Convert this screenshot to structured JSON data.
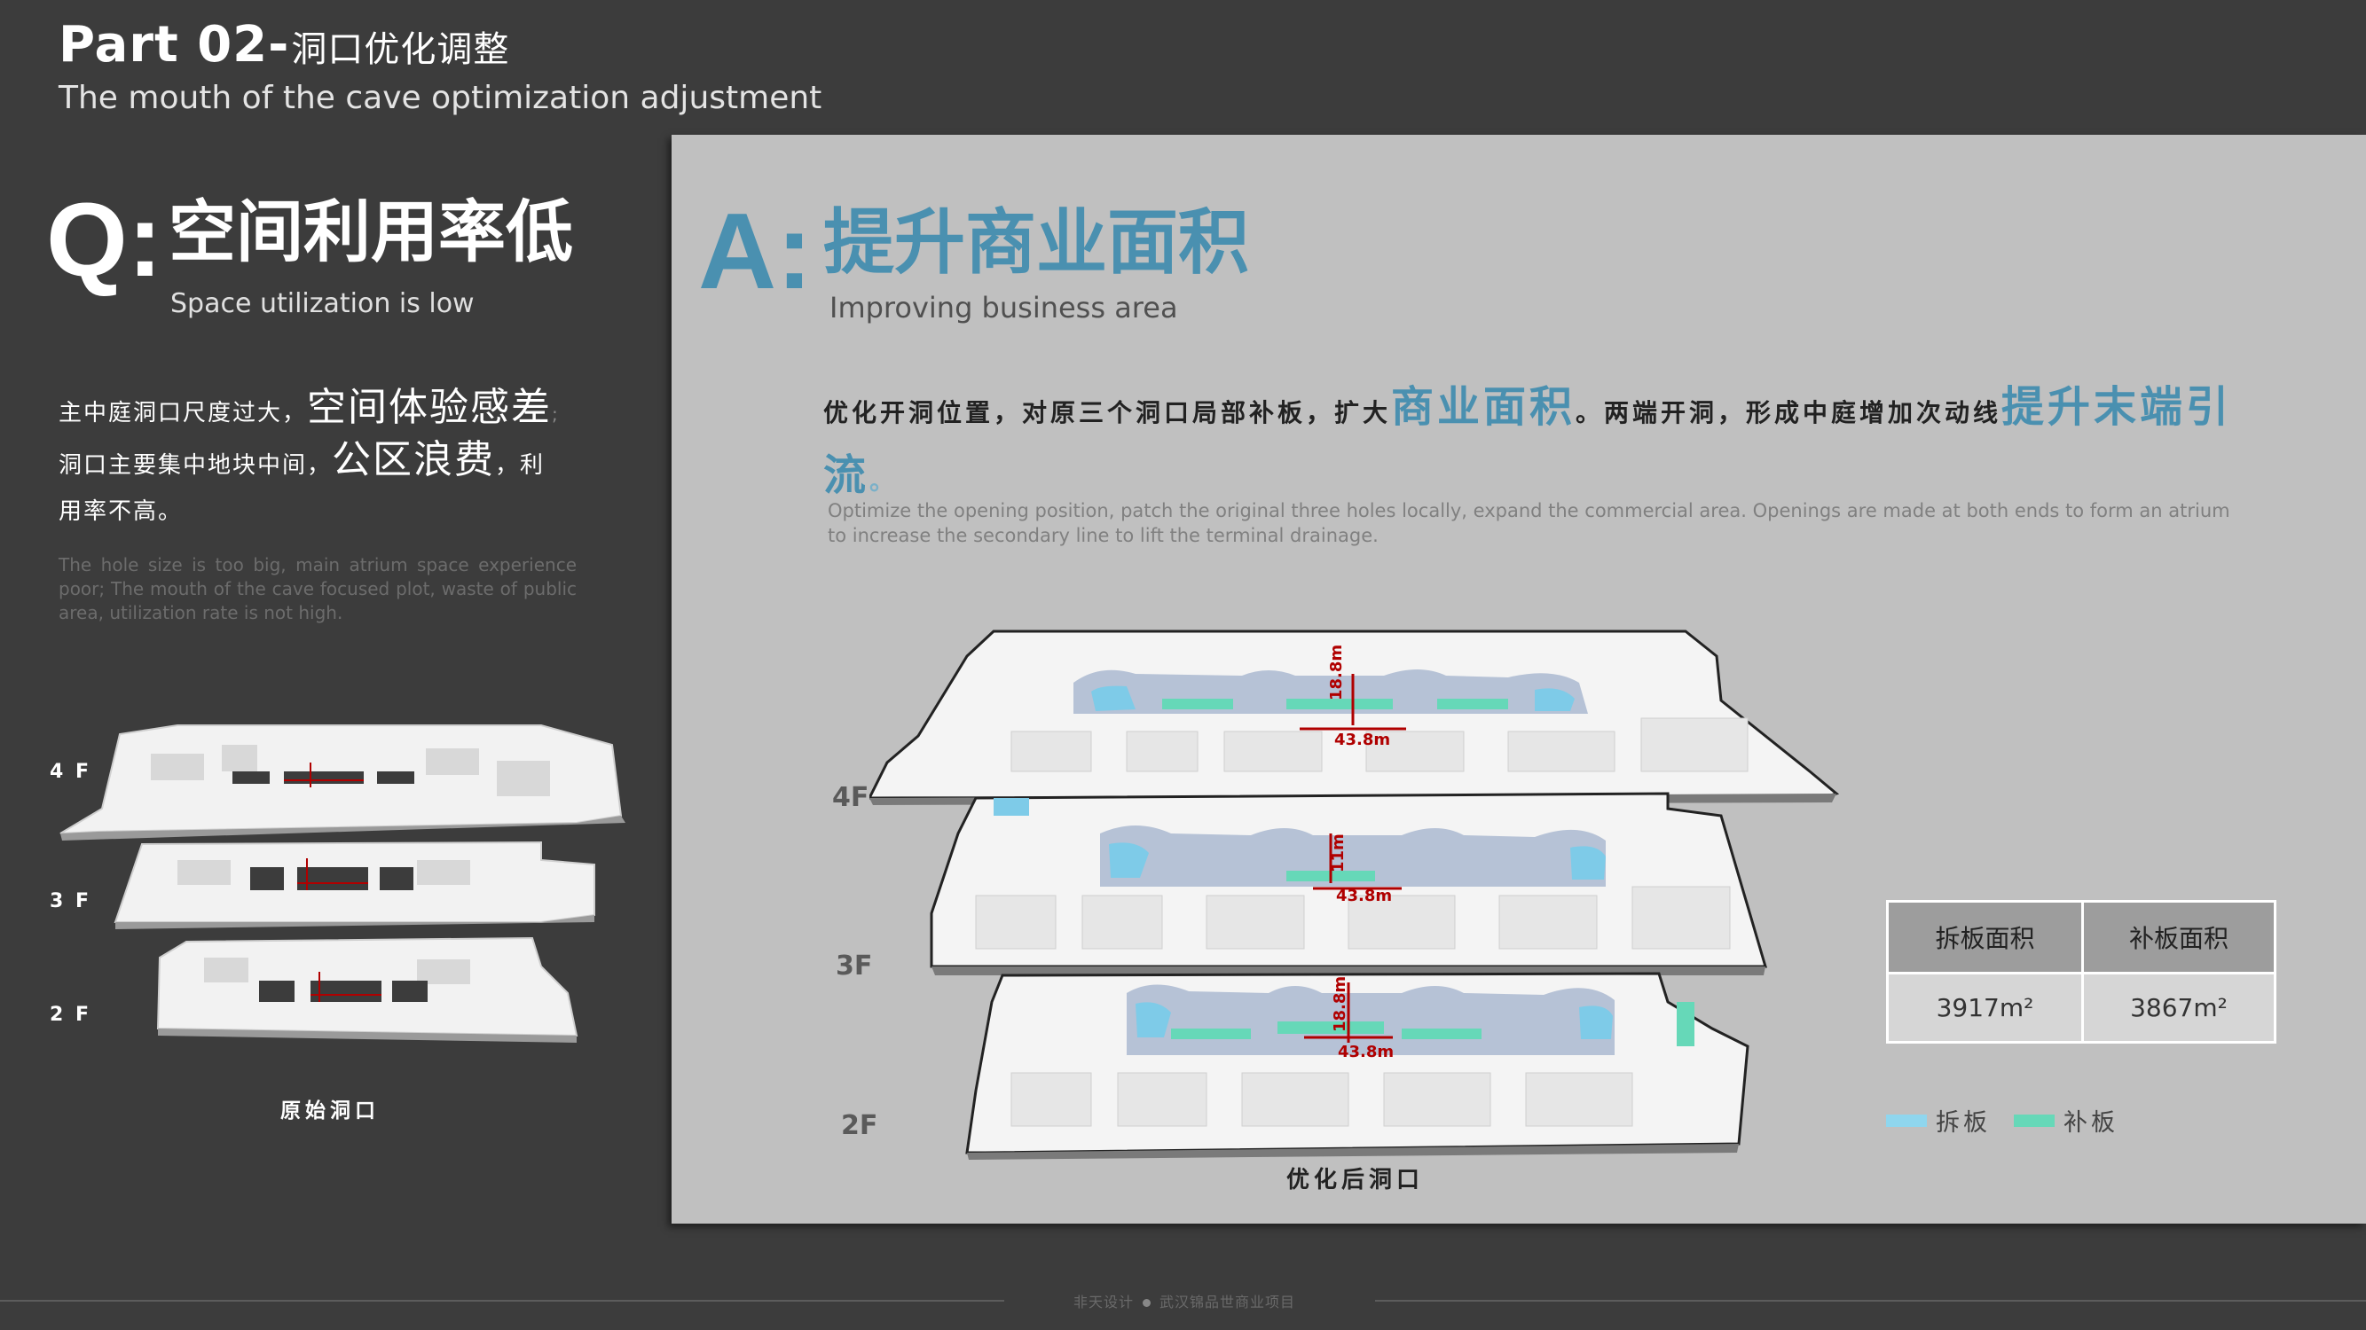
{
  "header": {
    "part": "Part 02-",
    "part_cn": "洞口优化调整",
    "subtitle": "The mouth of the cave optimization adjustment"
  },
  "question": {
    "letter": "Q:",
    "title": "空间利用率低",
    "subtitle": "Space utilization is low",
    "text_1": "主中庭洞口尺度过大，",
    "text_1_big": "空间体验感差",
    "text_1_end": ";",
    "text_2": "洞口主要集中地块中间，",
    "text_2_big": "公区浪费",
    "text_2_end": "，利",
    "text_3": "用率不高。",
    "english": "The hole size is too big, main atrium space experience poor; The mouth of the cave focused plot, waste of public area, utilization rate is not high.",
    "floors": [
      "4 F",
      "3 F",
      "2 F"
    ],
    "caption": "原始洞口"
  },
  "answer": {
    "letter": "A:",
    "title": "提升商业面积",
    "subtitle": "Improving business area",
    "text_a": "优化开洞位置，对原三个洞口局部补板，扩大",
    "text_a_hl": "商业面积",
    "text_b": "。两端开洞，形成中庭增加次动线",
    "text_b_hl": "提升末端引流",
    "text_c": "。",
    "english": "Optimize the opening position, patch the original three holes locally, expand the commercial area. Openings are made at both ends to form an atrium to increase the secondary line to lift the terminal drainage.",
    "floors": [
      "4F",
      "3F",
      "2F"
    ],
    "dims": {
      "f4_w": "43.8m",
      "f4_h": "18.8m",
      "f3_w": "43.8m",
      "f3_h": "11m",
      "f2_w": "43.8m",
      "f2_h": "18.8m"
    },
    "caption": "优化后洞口"
  },
  "table": {
    "headers": [
      "拆板面积",
      "补板面积"
    ],
    "values": [
      "3917m²",
      "3867m²"
    ]
  },
  "legend": [
    {
      "label": "拆板",
      "color": "#8fd6ee"
    },
    {
      "label": "补板",
      "color": "#66d8b8"
    }
  ],
  "footer": {
    "brand": "非天设计",
    "project": "武汉锦品世商业项目"
  }
}
